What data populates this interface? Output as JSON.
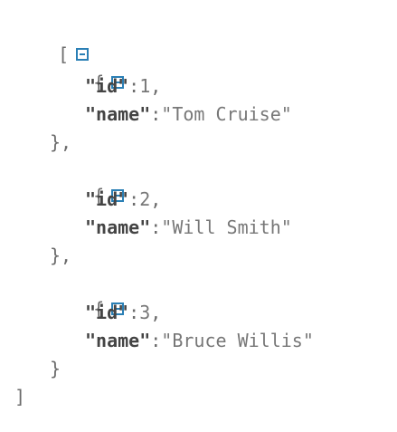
{
  "root": {
    "open": "[",
    "close": "]",
    "toggle_icon": "collapse-minus-icon"
  },
  "items": [
    {
      "open": "{",
      "close": "},",
      "fields": [
        {
          "key": "\"id\"",
          "sep": ":",
          "value": "1",
          "trail": ","
        },
        {
          "key": "\"name\"",
          "sep": ":",
          "value": "\"Tom Cruise\"",
          "trail": ""
        }
      ]
    },
    {
      "open": "{",
      "close": "},",
      "fields": [
        {
          "key": "\"id\"",
          "sep": ":",
          "value": "2",
          "trail": ","
        },
        {
          "key": "\"name\"",
          "sep": ":",
          "value": "\"Will Smith\"",
          "trail": ""
        }
      ]
    },
    {
      "open": "{",
      "close": "}",
      "fields": [
        {
          "key": "\"id\"",
          "sep": ":",
          "value": "3",
          "trail": ","
        },
        {
          "key": "\"name\"",
          "sep": ":",
          "value": "\"Bruce Willis\"",
          "trail": ""
        }
      ]
    }
  ],
  "colors": {
    "toggle": "#2a7fb5",
    "key": "#444444",
    "punctuation": "#6b6b6b"
  }
}
